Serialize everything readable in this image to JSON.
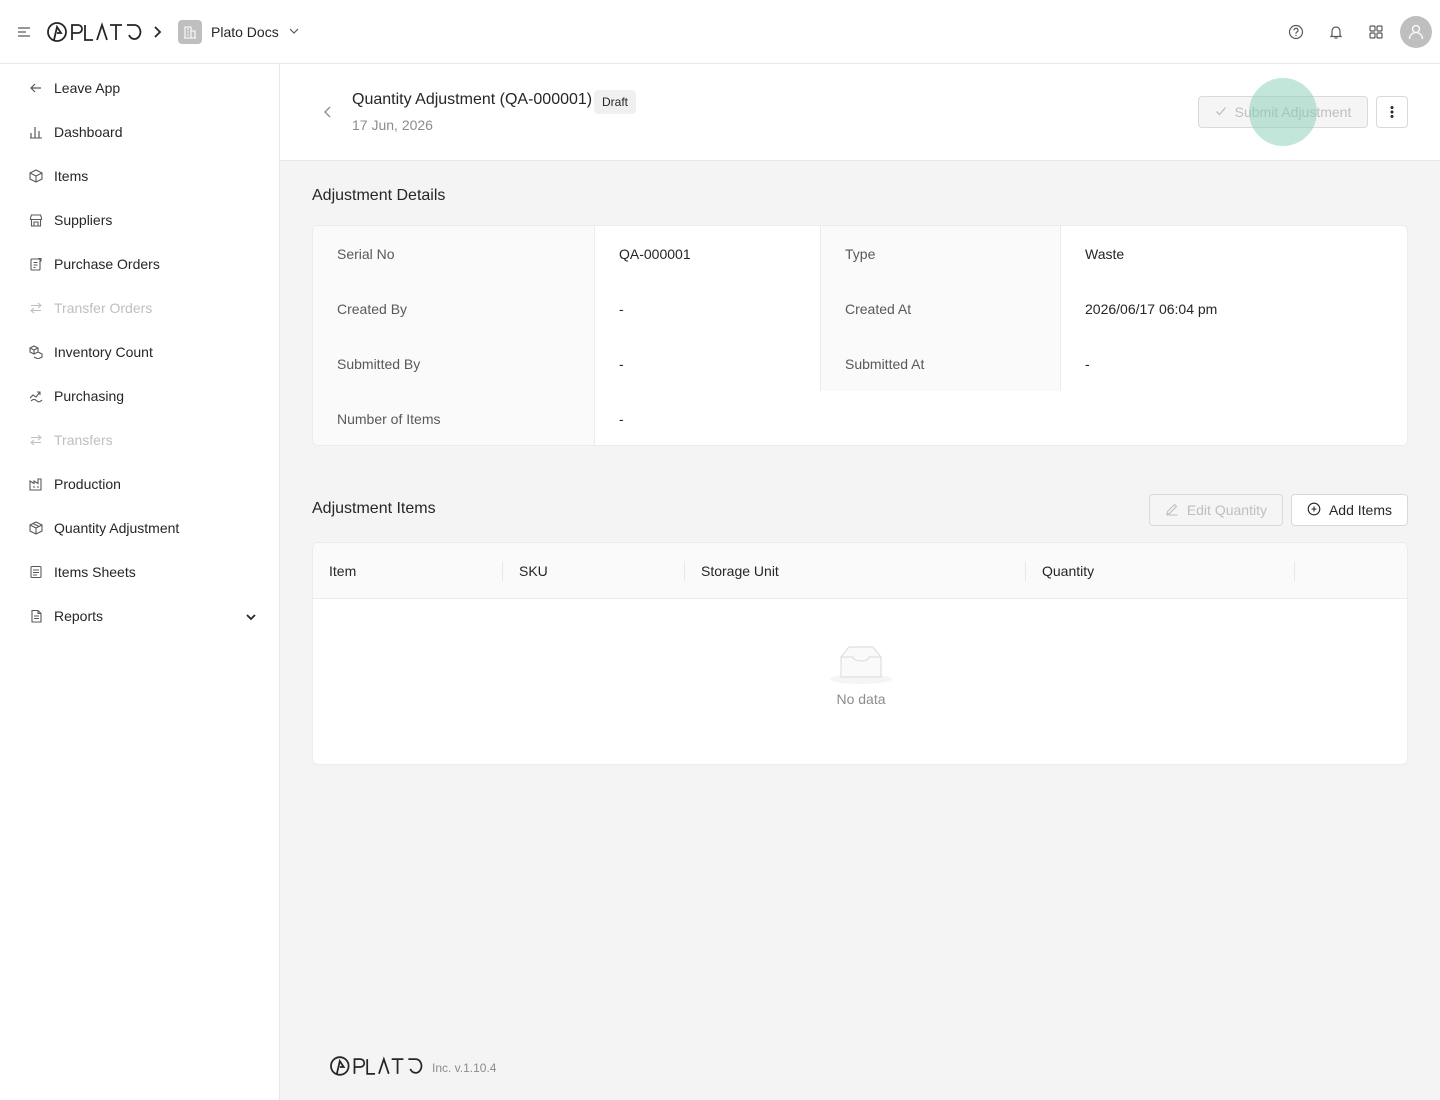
{
  "header": {
    "logo_text": "PLATO",
    "org_name": "Plato Docs"
  },
  "sidebar": {
    "items": [
      {
        "label": "Leave App",
        "icon": "arrow-left-icon",
        "disabled": false
      },
      {
        "label": "Dashboard",
        "icon": "bar-chart-icon",
        "disabled": false
      },
      {
        "label": "Items",
        "icon": "box-icon",
        "disabled": false
      },
      {
        "label": "Suppliers",
        "icon": "store-icon",
        "disabled": false
      },
      {
        "label": "Purchase Orders",
        "icon": "clipboard-icon",
        "disabled": false
      },
      {
        "label": "Transfer Orders",
        "icon": "transfer-icon",
        "disabled": true
      },
      {
        "label": "Inventory Count",
        "icon": "boxes-icon",
        "disabled": false
      },
      {
        "label": "Purchasing",
        "icon": "purchasing-icon",
        "disabled": false
      },
      {
        "label": "Transfers",
        "icon": "transfer-icon",
        "disabled": true
      },
      {
        "label": "Production",
        "icon": "factory-icon",
        "disabled": false
      },
      {
        "label": "Quantity Adjustment",
        "icon": "box-adjust-icon",
        "disabled": false
      },
      {
        "label": "Items Sheets",
        "icon": "sheet-icon",
        "disabled": false
      },
      {
        "label": "Reports",
        "icon": "report-icon",
        "disabled": false
      }
    ]
  },
  "page": {
    "title": "Quantity Adjustment (QA-000001)",
    "status": "Draft",
    "date": "17 Jun, 2026",
    "submit_label": "Submit Adjustment"
  },
  "details": {
    "title": "Adjustment Details",
    "serial_no_label": "Serial No",
    "serial_no_value": "QA-000001",
    "type_label": "Type",
    "type_value": "Waste",
    "created_by_label": "Created By",
    "created_by_value": "-",
    "created_at_label": "Created At",
    "created_at_value": "2026/06/17 06:04 pm",
    "submitted_by_label": "Submitted By",
    "submitted_by_value": "-",
    "submitted_at_label": "Submitted At",
    "submitted_at_value": "-",
    "num_items_label": "Number of Items",
    "num_items_value": "-"
  },
  "items": {
    "title": "Adjustment Items",
    "edit_quantity_label": "Edit Quantity",
    "add_items_label": "Add Items",
    "columns": [
      "Item",
      "SKU",
      "Storage Unit",
      "Quantity"
    ],
    "empty_text": "No data"
  },
  "footer": {
    "logo_text": "PLATO",
    "version": "Inc. v.1.10.4"
  },
  "colors": {
    "accent_ring": "#85cdb4",
    "text": "#262626",
    "muted": "#8c8c8c",
    "disabled": "#bfbfbf"
  }
}
